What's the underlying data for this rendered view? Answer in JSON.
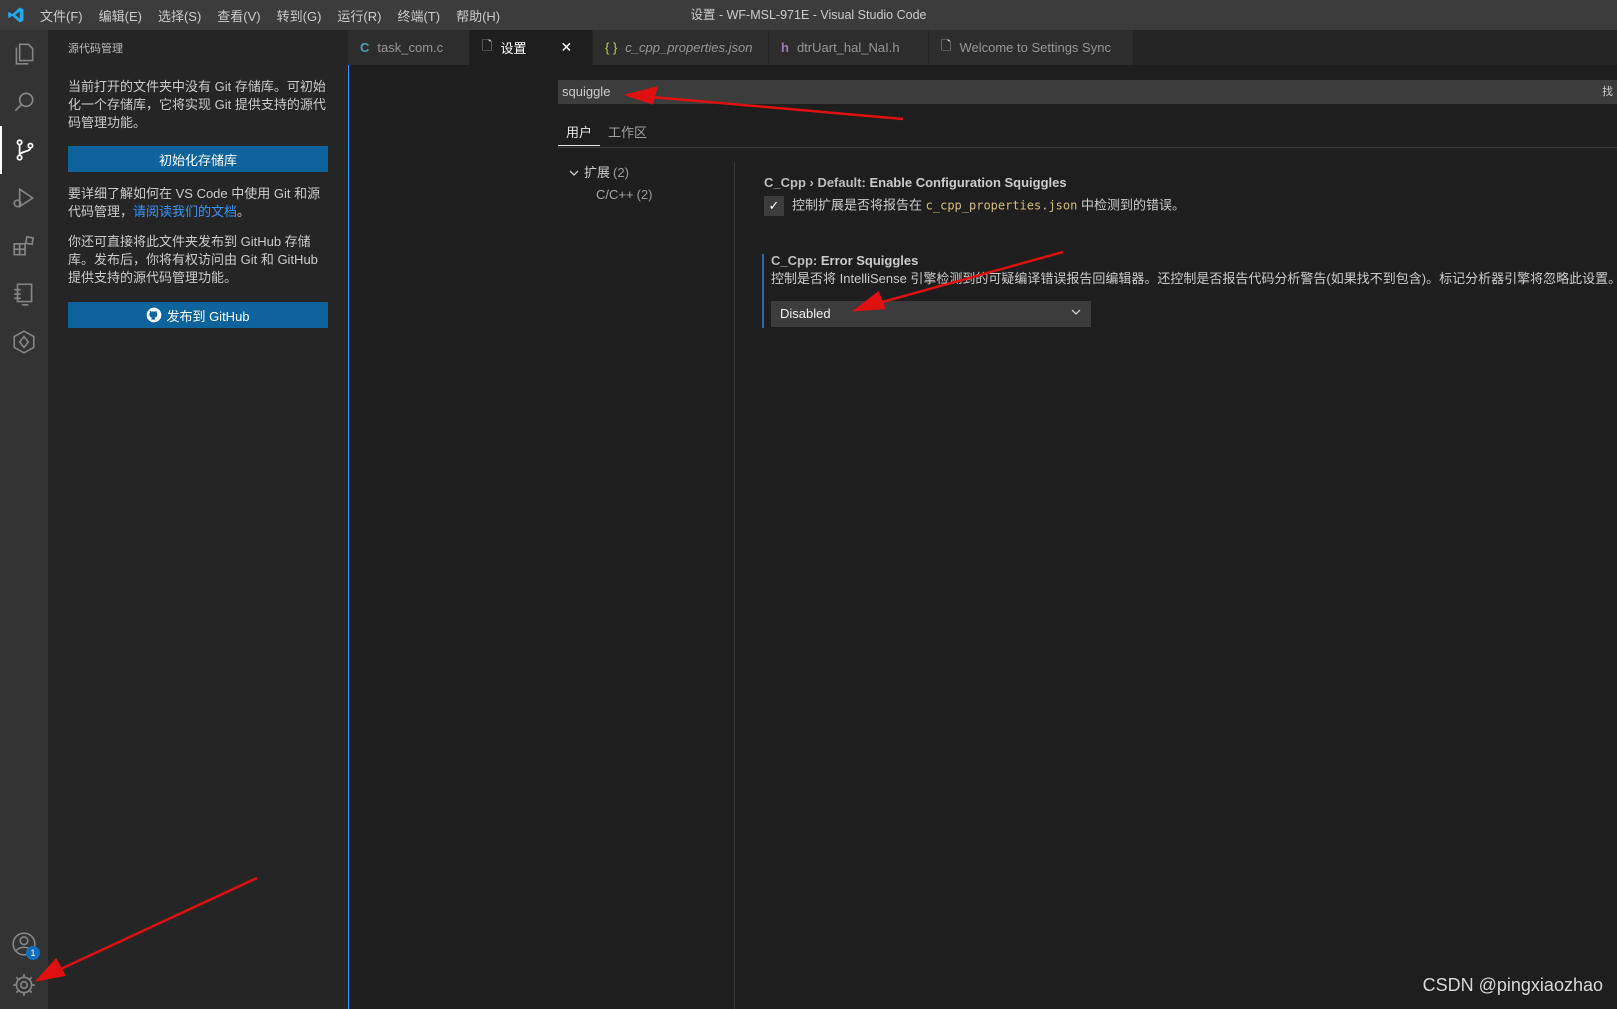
{
  "window": {
    "title": "设置 - WF-MSL-971E - Visual Studio Code"
  },
  "menu": [
    "文件(F)",
    "编辑(E)",
    "选择(S)",
    "查看(V)",
    "转到(G)",
    "运行(R)",
    "终端(T)",
    "帮助(H)"
  ],
  "activity": {
    "accounts_badge": "1"
  },
  "sidebar": {
    "header": "源代码管理",
    "intro": "当前打开的文件夹中没有 Git 存储库。可初始化一个存储库，它将实现 Git 提供支持的源代码管理功能。",
    "init_button": "初始化存储库",
    "learn_prefix": "要详细了解如何在 VS Code 中使用 Git 和源代码管理，",
    "learn_link": "请阅读我们的文档",
    "learn_suffix": "。",
    "publish_text": "你还可直接将此文件夹发布到 GitHub 存储库。发布后，你将有权访问由 Git 和 GitHub 提供支持的源代码管理功能。",
    "publish_button": "发布到 GitHub"
  },
  "tabs": [
    {
      "icon": "C",
      "label": "task_com.c"
    },
    {
      "icon": "🗋",
      "label": "设置",
      "close": "✕"
    },
    {
      "icon": "{ }",
      "label": "c_cpp_properties.json"
    },
    {
      "icon": "h",
      "label": "dtrUart_hal_NaI.h"
    },
    {
      "icon": "🗋",
      "label": "Welcome to Settings Sync"
    }
  ],
  "settings": {
    "search_value": "squiggle",
    "find_label": "找",
    "scope_tabs": [
      "用户",
      "工作区"
    ],
    "toc": {
      "group": "扩展",
      "group_count": "(2)",
      "child": "C/C++",
      "child_count": "(2)"
    },
    "item1": {
      "category": "C_Cpp › Default: ",
      "name": "Enable Configuration Squiggles",
      "desc_prefix": "控制扩展是否将报告在",
      "desc_code": "c_cpp_properties.json",
      "desc_suffix": "中检测到的错误。",
      "checked": "✓"
    },
    "item2": {
      "category": "C_Cpp: ",
      "name": "Error Squiggles",
      "desc": "控制是否将 IntelliSense 引擎检测到的可疑编译错误报告回编辑器。还控制是否报告代码分析警告(如果找不到包含)。标记分析器引擎将忽略此设置。",
      "value": "Disabled"
    }
  },
  "watermark": "CSDN @pingxiaozhao",
  "colors": {
    "accent": "#0e639c",
    "arrow": "#e01010",
    "link": "#3794ff"
  }
}
